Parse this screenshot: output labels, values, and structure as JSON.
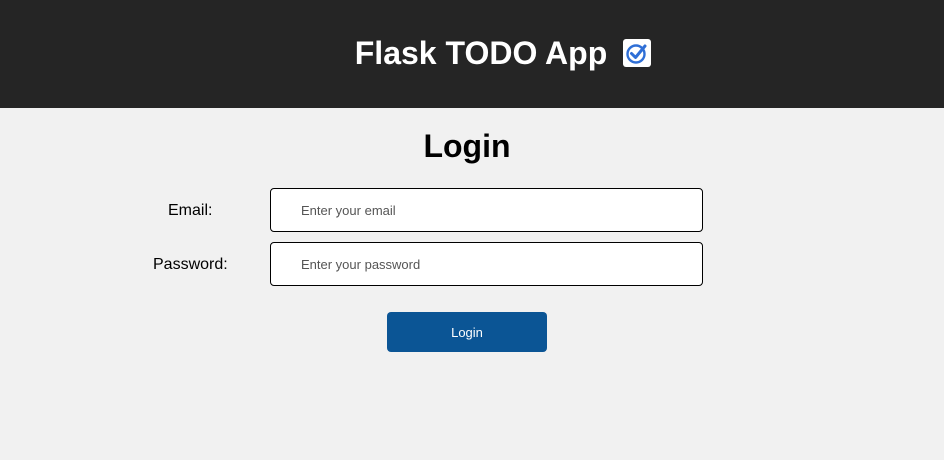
{
  "header": {
    "title": "Flask TODO App",
    "icon": "checkbox-check-icon",
    "background": "#252525"
  },
  "login": {
    "heading": "Login",
    "email_label": "Email:",
    "email_placeholder": "Enter your email",
    "email_value": "",
    "password_label": "Password:",
    "password_placeholder": "Enter your password",
    "password_value": "",
    "button_label": "Login",
    "button_color": "#0b5595"
  }
}
